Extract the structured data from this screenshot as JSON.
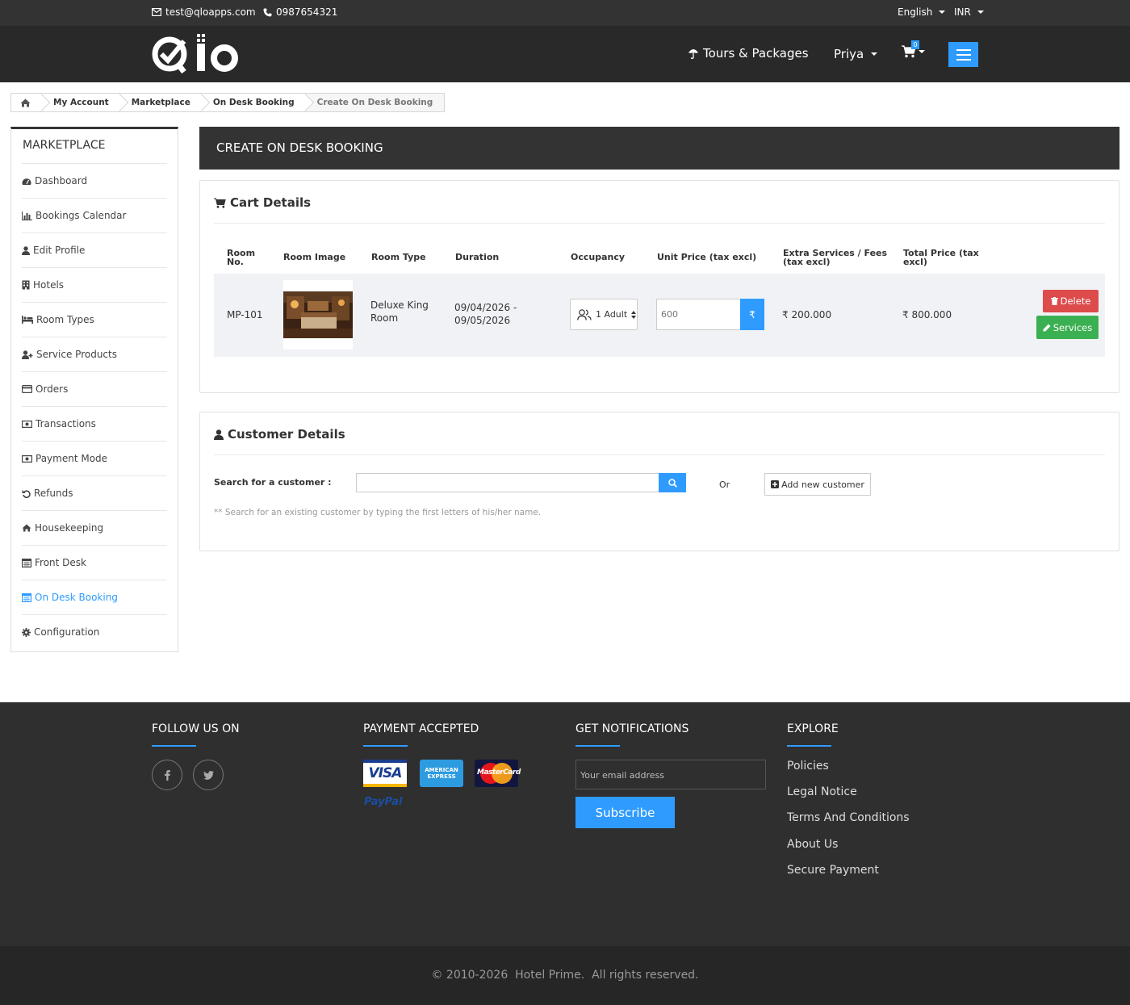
{
  "topbar": {
    "email": "test@qloapps.com",
    "phone": "0987654321",
    "language": "English",
    "currency": "INR"
  },
  "header": {
    "logo": "Qlo",
    "tours": "Tours & Packages",
    "user": "Priya",
    "cart_count": "0"
  },
  "breadcrumb": {
    "items": [
      "My Account",
      "Marketplace",
      "On Desk Booking"
    ],
    "current": "Create On Desk Booking"
  },
  "sidebar": {
    "title": "MARKETPLACE",
    "items": [
      {
        "label": "Dashboard",
        "icon": "dashboard-icon"
      },
      {
        "label": "Bookings Calendar",
        "icon": "bar-chart-icon"
      },
      {
        "label": "Edit Profile",
        "icon": "user-icon"
      },
      {
        "label": "Hotels",
        "icon": "building-icon"
      },
      {
        "label": "Room Types",
        "icon": "bed-icon"
      },
      {
        "label": "Service Products",
        "icon": "user-plus-icon"
      },
      {
        "label": "Orders",
        "icon": "credit-card-icon"
      },
      {
        "label": "Transactions",
        "icon": "money-icon"
      },
      {
        "label": "Payment Mode",
        "icon": "money-icon"
      },
      {
        "label": "Refunds",
        "icon": "undo-icon"
      },
      {
        "label": "Housekeeping",
        "icon": "home-icon"
      },
      {
        "label": "Front Desk",
        "icon": "calendar-icon"
      },
      {
        "label": "On Desk Booking",
        "icon": "calendar-icon",
        "active": true
      },
      {
        "label": "Configuration",
        "icon": "gear-icon"
      }
    ]
  },
  "main": {
    "title": "CREATE ON DESK BOOKING",
    "cart": {
      "title": "Cart Details",
      "headers": {
        "room_no": "Room No.",
        "room_image": "Room Image",
        "room_type": "Room Type",
        "duration": "Duration",
        "occupancy": "Occupancy",
        "unit_price": "Unit Price (tax excl)",
        "extra": "Extra Services / Fees (tax excl)",
        "total": "Total Price (tax excl)"
      },
      "row": {
        "room_no": "MP-101",
        "room_type": "Deluxe King Room",
        "duration": "09/04/2026 - 09/05/2026",
        "occupancy": "1 Adult",
        "unit_price_placeholder": "600",
        "currency_symbol": "₹",
        "extra": "₹ 200.000",
        "total": "₹ 800.000",
        "delete_label": "Delete",
        "services_label": "Services"
      }
    },
    "customer": {
      "title": "Customer Details",
      "search_label": "Search for a customer :",
      "or": "Or",
      "add_label": "Add new customer",
      "hint": "** Search for an existing customer by typing the first letters of his/her name."
    }
  },
  "footer": {
    "follow": "FOLLOW US ON",
    "payment": "PAYMENT ACCEPTED",
    "payment_logos": {
      "visa": "VISA",
      "amex_line1": "AMERICAN",
      "amex_line2": "EXPRESS",
      "mastercard": "MasterCard",
      "paypal": "PayPal"
    },
    "notifications": "GET NOTIFICATIONS",
    "email_placeholder": "Your email address",
    "subscribe": "Subscribe",
    "explore": "EXPLORE",
    "links": [
      "Policies",
      "Legal Notice",
      "Terms And Conditions",
      "About Us",
      "Secure Payment"
    ],
    "copyright": "© 2010-2026  Hotel Prime.  All rights reserved."
  },
  "colors": {
    "accent": "#2f9bff",
    "dark": "#333333",
    "danger": "#dd4b4b",
    "success": "#3bb052"
  }
}
